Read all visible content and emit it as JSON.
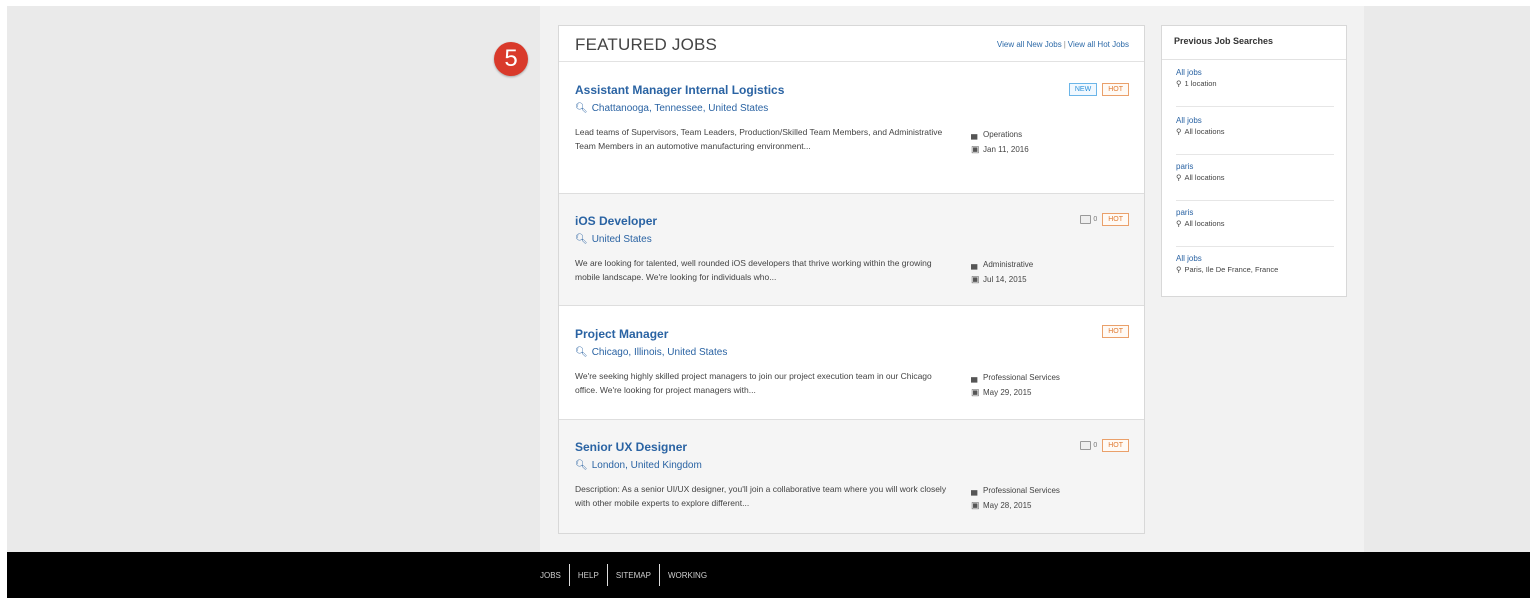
{
  "step_marker": "5",
  "featured": {
    "title": "FEATURED JOBS",
    "view_new": "View all New Jobs",
    "separator": "|",
    "view_hot": "View all Hot Jobs"
  },
  "jobs": [
    {
      "title": "Assistant Manager Internal Logistics",
      "location": "Chattanooga, Tennessee, United States",
      "description": "Lead teams of Supervisors, Team Leaders, Production/Skilled Team Members, and Administrative Team Members in an automotive manufacturing environment...",
      "category": "Operations",
      "date": "Jan 11, 2016",
      "new_badge": "NEW",
      "hot_badge": "HOT"
    },
    {
      "title": "iOS Developer",
      "location": "United States",
      "description": "We are looking for talented, well rounded iOS developers that thrive working within the growing mobile landscape. We're looking for individuals who...",
      "category": "Administrative",
      "date": "Jul 14, 2015",
      "comment_count": "0",
      "hot_badge": "HOT"
    },
    {
      "title": "Project Manager",
      "location": "Chicago, Illinois, United States",
      "description": "We're seeking highly skilled project managers to join our project execution team in our Chicago office. We're looking for project managers with...",
      "category": "Professional Services",
      "date": "May 29, 2015",
      "hot_badge": "HOT"
    },
    {
      "title": "Senior UX Designer",
      "location": "London, United Kingdom",
      "description": "Description: As a senior UI/UX designer, you'll join a collaborative team where you will work closely with other mobile experts to explore different...",
      "category": "Professional Services",
      "date": "May 28, 2015",
      "comment_count": "0",
      "hot_badge": "HOT"
    }
  ],
  "previous_searches": {
    "title": "Previous Job Searches",
    "items": [
      {
        "query": "All jobs",
        "location": "1 location"
      },
      {
        "query": "All jobs",
        "location": "All locations"
      },
      {
        "query": "paris",
        "location": "All locations"
      },
      {
        "query": "paris",
        "location": "All locations"
      },
      {
        "query": "All jobs",
        "location": "Paris, Ile De France, France"
      }
    ]
  },
  "footer": {
    "links": [
      "JOBS",
      "HELP",
      "SITEMAP",
      "WORKING"
    ]
  },
  "icons": {
    "search": "search-icon",
    "folder": "folder-icon",
    "calendar": "calendar-icon",
    "pin": "map-pin-icon",
    "comment": "comment-icon"
  },
  "colors": {
    "link": "#2a63a3",
    "new_badge": "#2a8fd8",
    "hot_badge": "#e07a30",
    "step_marker": "#d93a2b",
    "footer": "#000000"
  }
}
